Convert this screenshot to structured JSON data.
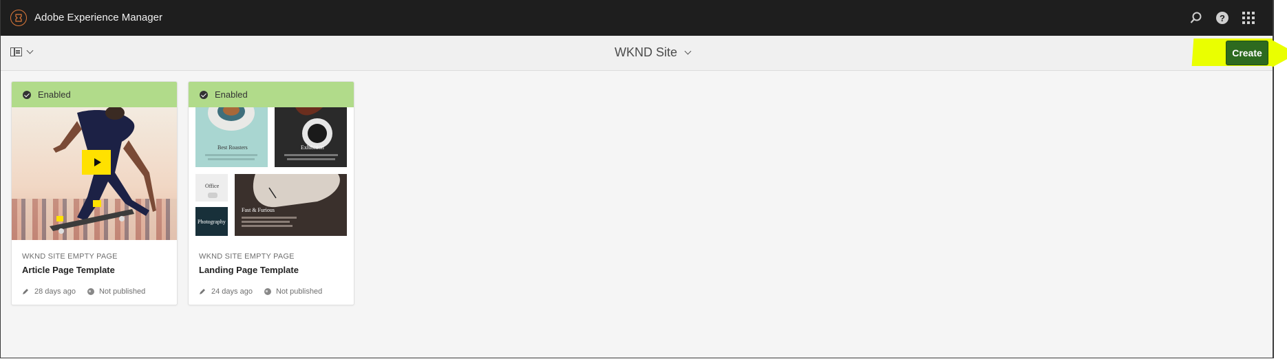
{
  "shell": {
    "brand": "Adobe Experience Manager",
    "icons": [
      "adobe-logo-icon",
      "search-icon",
      "help-icon",
      "apps-grid-icon"
    ]
  },
  "actionbar": {
    "site_title": "WKND Site",
    "create_label": "Create"
  },
  "cards": [
    {
      "status": "Enabled",
      "eyebrow": "WKND SITE EMPTY PAGE",
      "title": "Article Page Template",
      "modified": "28 days ago",
      "publish_status": "Not published"
    },
    {
      "status": "Enabled",
      "eyebrow": "WKND SITE EMPTY PAGE",
      "title": "Landing Page Template",
      "modified": "24 days ago",
      "publish_status": "Not published",
      "thumbnail_texts": {
        "roasters": "Best Roasters",
        "exhibit": "Exhibition",
        "office": "Office",
        "photo": "Photography",
        "fast": "Fast & Furious"
      }
    }
  ],
  "colors": {
    "shell_bg": "#1e1e1e",
    "status_enabled": "#b1db8a",
    "create_button": "#2d6a1f",
    "highlight": "#eaff00"
  }
}
